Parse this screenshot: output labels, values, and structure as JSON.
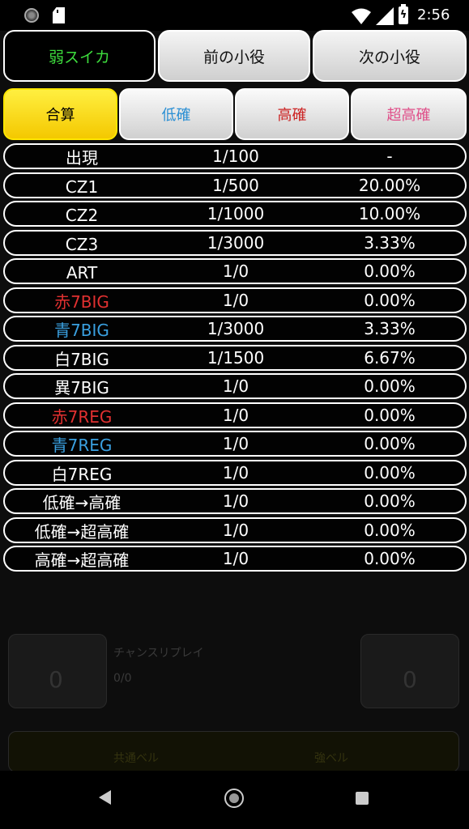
{
  "status_bar": {
    "time": "2:56",
    "battery_symbol": "ϟ"
  },
  "top_buttons": {
    "small_role": "弱スイカ",
    "prev_label": "前の小役",
    "next_label": "次の小役"
  },
  "tabs": [
    "合算",
    "低確",
    "高確",
    "超高確"
  ],
  "tab_colors": {
    "active_bg": "#f4d000",
    "低確": "#2a8fd4",
    "高確": "#cc2222",
    "超高確": "#e0508a"
  },
  "rows": [
    {
      "label": "出現",
      "prob": "1/100",
      "rate": "-",
      "color": "#ffffff"
    },
    {
      "label": "CZ1",
      "prob": "1/500",
      "rate": "20.00%",
      "color": "#ffffff"
    },
    {
      "label": "CZ2",
      "prob": "1/1000",
      "rate": "10.00%",
      "color": "#ffffff"
    },
    {
      "label": "CZ3",
      "prob": "1/3000",
      "rate": "3.33%",
      "color": "#ffffff"
    },
    {
      "label": "ART",
      "prob": "1/0",
      "rate": "0.00%",
      "color": "#ffffff"
    },
    {
      "label": "赤7BIG",
      "prob": "1/0",
      "rate": "0.00%",
      "color": "#e03030"
    },
    {
      "label": "青7BIG",
      "prob": "1/3000",
      "rate": "3.33%",
      "color": "#3aa0e0"
    },
    {
      "label": "白7BIG",
      "prob": "1/1500",
      "rate": "6.67%",
      "color": "#ffffff"
    },
    {
      "label": "異7BIG",
      "prob": "1/0",
      "rate": "0.00%",
      "color": "#ffffff"
    },
    {
      "label": "赤7REG",
      "prob": "1/0",
      "rate": "0.00%",
      "color": "#e03030"
    },
    {
      "label": "青7REG",
      "prob": "1/0",
      "rate": "0.00%",
      "color": "#3aa0e0"
    },
    {
      "label": "白7REG",
      "prob": "1/0",
      "rate": "0.00%",
      "color": "#ffffff"
    },
    {
      "label": "低確→高確",
      "prob": "1/0",
      "rate": "0.00%",
      "color": "#ffffff"
    },
    {
      "label": "低確→超高確",
      "prob": "1/0",
      "rate": "0.00%",
      "color": "#ffffff"
    },
    {
      "label": "高確→超高確",
      "prob": "1/0",
      "rate": "0.00%",
      "color": "#ffffff"
    }
  ],
  "background_app": {
    "label_a": "チャンスリプレイ",
    "label_b": "共通ベル",
    "label_c": "強ベル",
    "value_a": "0/0",
    "count_a": "0",
    "count_b": "0"
  }
}
